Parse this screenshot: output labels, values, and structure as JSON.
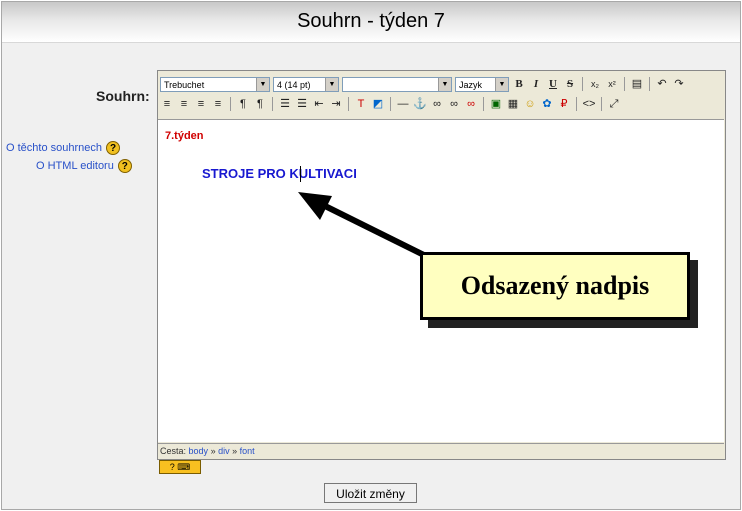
{
  "title": "Souhrn - týden 7",
  "summary_label": "Souhrn:",
  "help_links": [
    {
      "label": "O těchto souhrnech",
      "icon": "?"
    },
    {
      "label": "O HTML editoru",
      "icon": "?"
    }
  ],
  "toolbar": {
    "font_family": "Trebuchet",
    "font_size": "4 (14 pt)",
    "style_value": "",
    "language": "Jazyk",
    "bold": "B",
    "italic": "I",
    "underline": "U",
    "strike": "S",
    "subscript": "x₂",
    "superscript": "x²",
    "undo": "↶",
    "redo": "↷"
  },
  "content": {
    "heading": "7.týden",
    "subheading": "STROJE PRO KULTIVACI"
  },
  "path_bar": {
    "label": "Cesta:",
    "crumbs": [
      "body",
      "div",
      "font"
    ],
    "separator": "»"
  },
  "keyboard_help": "?",
  "save_button": "Uložit změny",
  "callout_text": "Odsazený nadpis"
}
